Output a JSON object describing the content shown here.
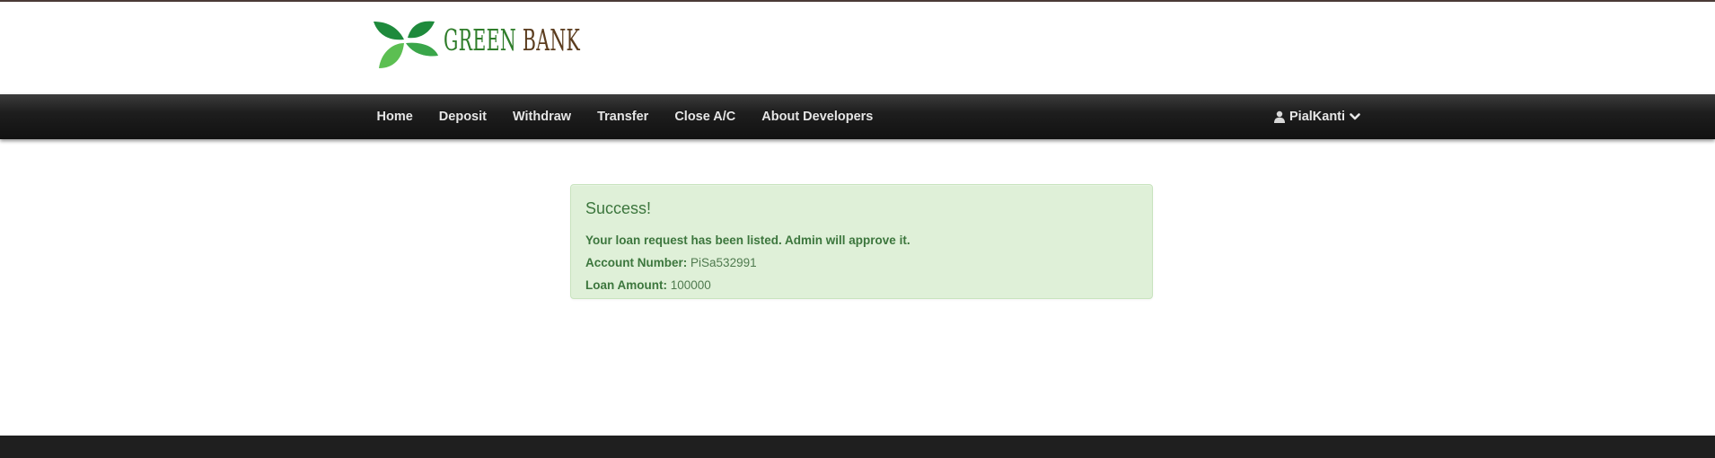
{
  "brand": {
    "name_part1": "GREEN",
    "name_part2": "BANK",
    "logo_icon": "leaf-logo-icon",
    "colors": {
      "green": "#2f7d2a",
      "brown": "#5b3c1e",
      "leaf_dark": "#1e8a3c",
      "leaf_light": "#5cbf52"
    }
  },
  "navbar": {
    "items": [
      {
        "label": "Home"
      },
      {
        "label": "Deposit"
      },
      {
        "label": "Withdraw"
      },
      {
        "label": "Transfer"
      },
      {
        "label": "Close A/C"
      },
      {
        "label": "About Developers"
      }
    ],
    "user": {
      "name": "PialKanti",
      "icon": "user-icon",
      "dropdown_icon": "chevron-down-icon"
    }
  },
  "alert": {
    "title": "Success!",
    "message": "Your loan request has been listed. Admin will approve it.",
    "account_number_label": "Account Number:",
    "account_number": "PiSa532991",
    "loan_amount_label": "Loan Amount:",
    "loan_amount": "100000",
    "colors": {
      "background": "#dff0d8",
      "border": "#c8e3be",
      "text": "#3c763d"
    }
  }
}
